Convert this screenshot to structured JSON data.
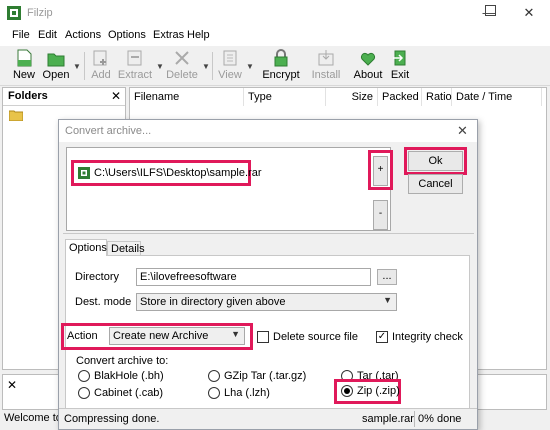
{
  "window": {
    "title": "Filzip",
    "min_icon": "minimize-icon",
    "max_icon": "maximize-icon",
    "close_icon": "close-icon"
  },
  "menu": [
    "File",
    "Edit",
    "Actions",
    "Options",
    "Extras",
    "Help"
  ],
  "toolbar": {
    "new": "New",
    "open": "Open",
    "add": "Add",
    "extract": "Extract",
    "delete": "Delete",
    "view": "View",
    "encrypt": "Encrypt",
    "install": "Install",
    "about": "About",
    "exit": "Exit"
  },
  "folders": {
    "title": "Folders",
    "close": "✕"
  },
  "columns": [
    "Filename",
    "Type",
    "Size",
    "Packed",
    "Ratio",
    "Date / Time"
  ],
  "status": {
    "welcome": "Welcome to Filzip",
    "compressing": "Compressing done.",
    "file": "sample.rar",
    "progress": "0% done"
  },
  "dialog": {
    "title": "Convert archive...",
    "file_path": "C:\\Users\\ILFS\\Desktop\\sample.rar",
    "add_label": "+",
    "remove_label": "-",
    "ok_label": "Ok",
    "cancel_label": "Cancel",
    "tabs": [
      "Options",
      "Details"
    ],
    "directory_label": "Directory",
    "directory_value": "E:\\ilovefreesoftware",
    "browse_label": "...",
    "dest_mode_label": "Dest. mode",
    "dest_mode_value": "Store in directory given above",
    "action_label": "Action",
    "action_value": "Create new Archive",
    "delete_source_label": "Delete source file",
    "delete_source_checked": false,
    "integrity_label": "Integrity check",
    "integrity_checked": true,
    "convert_to_label": "Convert archive to:",
    "formats": [
      "BlakHole (.bh)",
      "GZip Tar (.tar.gz)",
      "Tar (.tar)",
      "Cabinet (.cab)",
      "Lha (.lzh)",
      "Zip (.zip)"
    ],
    "selected_format": "Zip (.zip)",
    "highlight_color": "#e0195a"
  }
}
